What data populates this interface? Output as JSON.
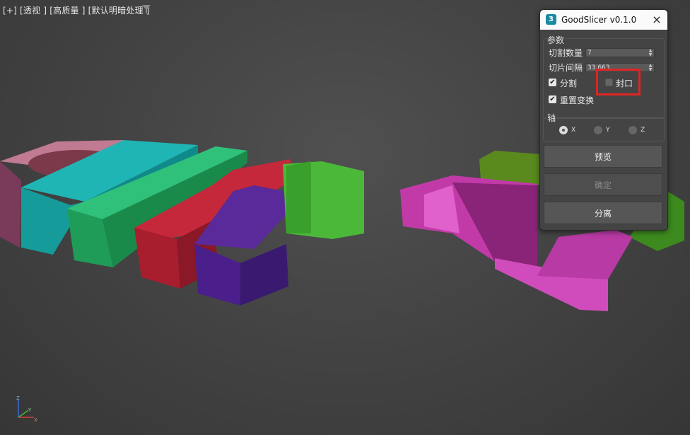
{
  "viewport": {
    "labels": [
      "[+]",
      "[透视 ]",
      "[高质量 ]",
      "[默认明暗处理 ]"
    ],
    "filter_icon": "filter-icon",
    "axis": {
      "x": "X",
      "y": "Y",
      "z": "Z"
    }
  },
  "dialog": {
    "logo": "3",
    "title": "GoodSlicer v0.1.0",
    "close_icon": "×",
    "params": {
      "group_title": "参数",
      "slice_count_label": "切割数量",
      "slice_count_value": "7",
      "slice_spacing_label": "切片间隔",
      "slice_spacing_value": "33.663",
      "split_label": "分割",
      "split_checked": true,
      "cap_label": "封口",
      "cap_checked": false,
      "reset_xform_label": "重置变换",
      "reset_xform_checked": true
    },
    "axis_group": {
      "group_title": "轴",
      "options": [
        "X",
        "Y",
        "Z"
      ],
      "selected": "X"
    },
    "buttons": {
      "preview": "预览",
      "confirm": "确定",
      "detach": "分离"
    },
    "highlight_color": "#e02424"
  }
}
